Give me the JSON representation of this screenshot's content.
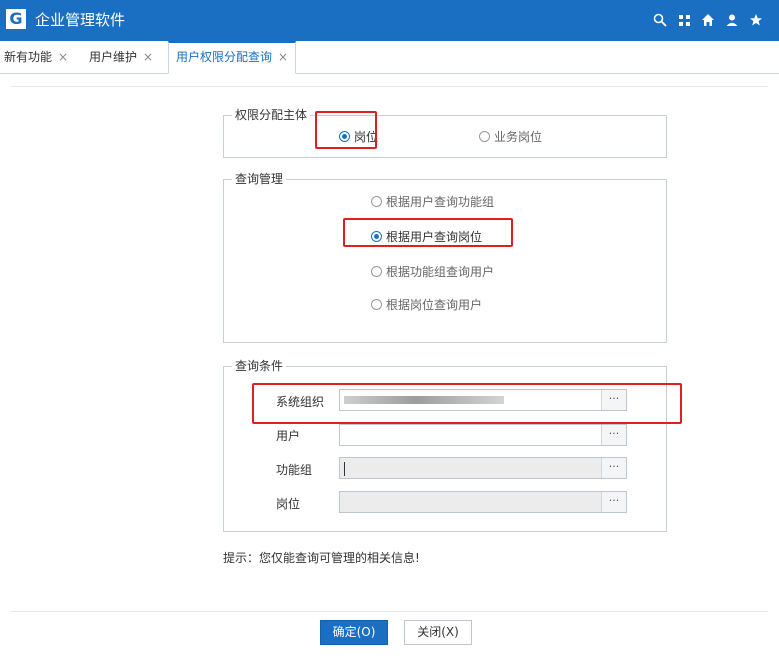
{
  "app": {
    "logo": "G",
    "title": "企业管理软件"
  },
  "top_icons": [
    "search-icon",
    "grid-icon",
    "home-icon",
    "user-icon",
    "star-icon"
  ],
  "tabs": [
    {
      "label": "新有功能",
      "close": "×"
    },
    {
      "label": "用户维护",
      "close": "×"
    },
    {
      "label": "用户权限分配查询",
      "close": "×"
    }
  ],
  "subject": {
    "legend": "权限分配主体",
    "options": [
      {
        "label": "岗位",
        "selected": true
      },
      {
        "label": "业务岗位",
        "selected": false
      }
    ]
  },
  "query_mgmt": {
    "legend": "查询管理",
    "options": [
      {
        "label": "根据用户查询功能组",
        "selected": false
      },
      {
        "label": "根据用户查询岗位",
        "selected": true
      },
      {
        "label": "根据功能组查询用户",
        "selected": false
      },
      {
        "label": "根据岗位查询用户",
        "selected": false
      }
    ]
  },
  "conditions": {
    "legend": "查询条件",
    "fields": [
      {
        "label": "系统组织",
        "value": "",
        "disabled": false,
        "ellipsis": "···"
      },
      {
        "label": "用户",
        "value": "",
        "disabled": false,
        "ellipsis": "···"
      },
      {
        "label": "功能组",
        "value": "",
        "disabled": true,
        "ellipsis": "···"
      },
      {
        "label": "岗位",
        "value": "",
        "disabled": true,
        "ellipsis": "···"
      }
    ]
  },
  "hint": "提示：您仅能查询可管理的相关信息!",
  "buttons": {
    "ok": "确定(O)",
    "close": "关闭(X)"
  },
  "colors": {
    "primary": "#1a6fc2",
    "highlight": "#e02020"
  }
}
